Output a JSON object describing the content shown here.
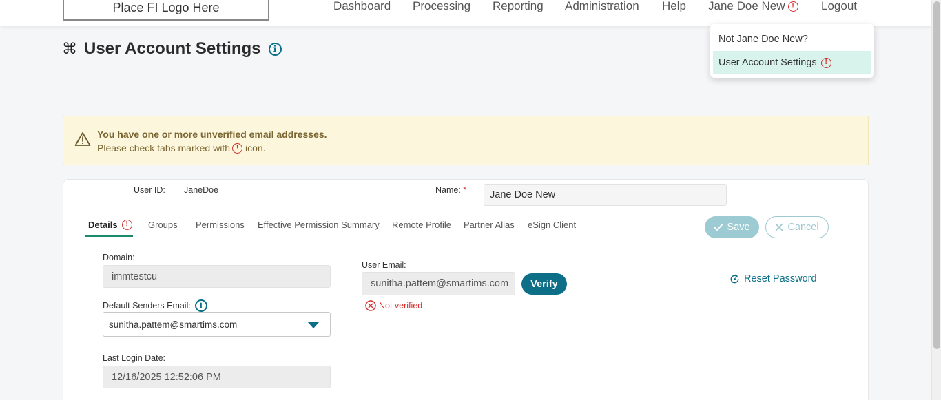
{
  "nav": {
    "logo_text": "Place FI Logo Here",
    "items": [
      "Dashboard",
      "Processing",
      "Reporting",
      "Administration",
      "Help"
    ],
    "user_name": "Jane Doe New",
    "logout": "Logout"
  },
  "user_menu": {
    "items": [
      "Not Jane Doe New?",
      "User Account Settings"
    ]
  },
  "page": {
    "title": "User Account Settings"
  },
  "alert": {
    "title": "You have one or more unverified email addresses.",
    "text_before": "Please check tabs marked with",
    "text_after": "icon."
  },
  "form_header": {
    "user_id_label": "User ID:",
    "user_id_value": "JaneDoe",
    "name_label": "Name:",
    "required_mark": "*",
    "name_value": "Jane Doe New"
  },
  "tabs": [
    "Details",
    "Groups",
    "Permissions",
    "Effective Permission Summary",
    "Remote Profile",
    "Partner Alias",
    "eSign Client"
  ],
  "actions": {
    "save": "Save",
    "cancel": "Cancel"
  },
  "details": {
    "domain_label": "Domain:",
    "domain_value": "immtestcu",
    "senders_label": "Default Senders Email:",
    "senders_value": "sunitha.pattem@smartims.com",
    "last_login_label": "Last Login Date:",
    "last_login_value": "12/16/2025 12:52:06 PM",
    "user_email_label": "User Email:",
    "user_email_value": "sunitha.pattem@smartims.com",
    "verify": "Verify",
    "not_verified": "Not verified",
    "reset_password": "Reset Password"
  },
  "colors": {
    "accent": "#0d6e87",
    "error": "#d32f2f",
    "alert_bg": "#fcf6dc",
    "menu_active": "#d8f3ec"
  }
}
